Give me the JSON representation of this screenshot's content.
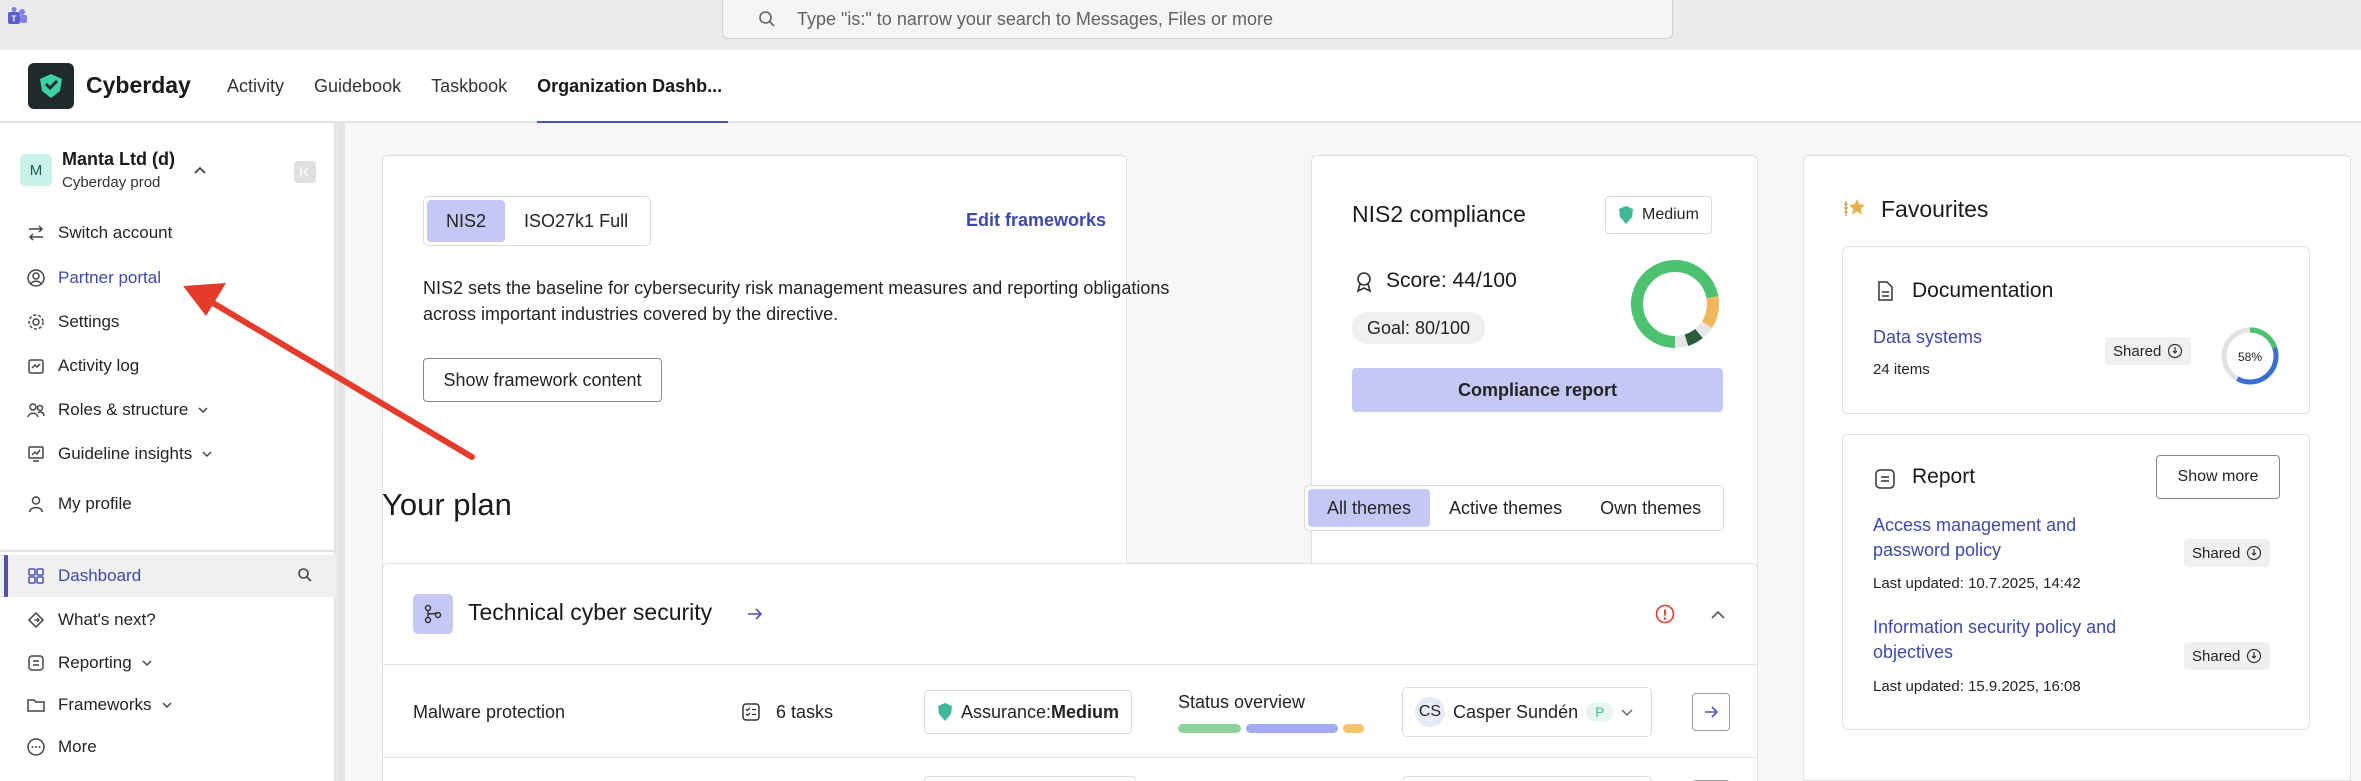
{
  "search": {
    "placeholder": "Type \"is:\" to narrow your search to Messages, Files or more"
  },
  "app": {
    "name": "Cyberday",
    "tabs": [
      {
        "label": "Activity"
      },
      {
        "label": "Guidebook"
      },
      {
        "label": "Taskbook"
      },
      {
        "label": "Organization Dashb..."
      }
    ]
  },
  "sidebar": {
    "account": {
      "avatar": "M",
      "name": "Manta Ltd (d)",
      "sub": "Cyberday prod"
    },
    "items": {
      "switch": "Switch account",
      "partner": "Partner portal",
      "settings": "Settings",
      "activity": "Activity log",
      "roles": "Roles & structure",
      "insights": "Guideline insights",
      "profile": "My profile",
      "dashboard": "Dashboard",
      "whatsnext": "What's next?",
      "reporting": "Reporting",
      "frameworks": "Frameworks",
      "more": "More"
    }
  },
  "framework_card": {
    "tabs": [
      "NIS2",
      "ISO27k1 Full"
    ],
    "edit_link": "Edit frameworks",
    "description": "NIS2 sets the baseline for cybersecurity risk management measures and reporting obligations across important industries covered by the directive.",
    "button": "Show framework content"
  },
  "compliance_card": {
    "title": "NIS2 compliance",
    "badge": "Medium",
    "score": "Score: 44/100",
    "goal": "Goal: 80/100",
    "button": "Compliance report",
    "donut": [
      {
        "color": "#4cc16f",
        "value": 0.72
      },
      {
        "color": "#f0b85a",
        "value": 0.12
      },
      {
        "color": "#e6e6e6",
        "value": 0.05
      },
      {
        "color": "#2a5c3a",
        "value": 0.06
      },
      {
        "color": "#e6e6e6",
        "value": 0.05
      }
    ]
  },
  "plan": {
    "title": "Your plan",
    "filters": [
      "All themes",
      "Active themes",
      "Own themes"
    ],
    "theme": {
      "title": "Technical cyber security",
      "row": {
        "name": "Malware protection",
        "tasks": "6 tasks",
        "assurance_label": "Assurance: ",
        "assurance_value": "Medium",
        "status_label": "Status overview",
        "status_bars": [
          {
            "color": "#8fd19b",
            "fraction": 0.36
          },
          {
            "color": "#a4abf0",
            "fraction": 0.52
          },
          {
            "color": "#f4c56a",
            "fraction": 0.12
          }
        ],
        "owner_initials": "CS",
        "owner_name": "Casper Sundén",
        "owner_tag": "P"
      }
    }
  },
  "favourites": {
    "title": "Favourites",
    "documentation": {
      "title": "Documentation",
      "item": "Data systems",
      "count": "24 items",
      "shared": "Shared",
      "percent": "58%",
      "progress": 0.58
    },
    "report": {
      "title": "Report",
      "show_more": "Show more",
      "items": [
        {
          "title": "Access management and password policy",
          "updated": "Last updated: 10.7.2025, 14:42",
          "shared": "Shared"
        },
        {
          "title": "Information security policy and objectives",
          "updated": "Last updated: 15.9.2025, 16:08",
          "shared": "Shared"
        }
      ]
    }
  },
  "colors": {
    "accent": "#4f52b2",
    "accent_soft": "#c5c8f5",
    "link": "#3e4aa8",
    "arrow": "#e53b2c"
  }
}
